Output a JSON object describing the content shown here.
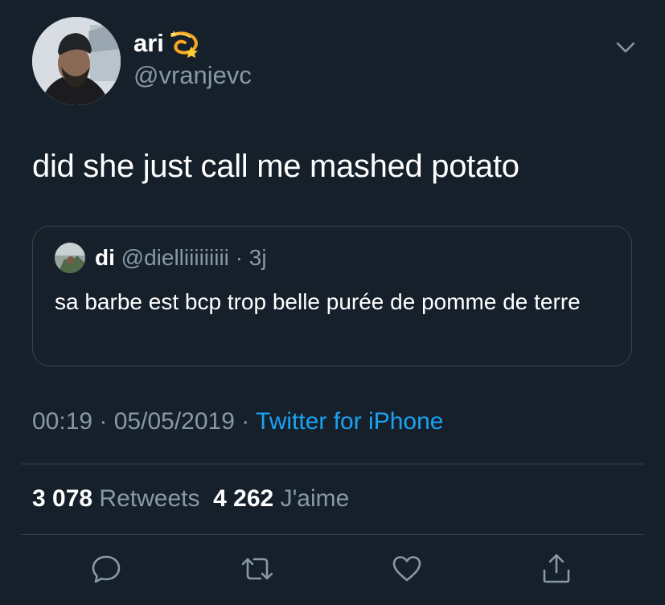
{
  "author": {
    "name": "ari",
    "name_emoji_icon": "dizzy-icon",
    "handle": "@vranjevc"
  },
  "tweet": {
    "text": "did she just call me mashed potato"
  },
  "quoted_tweet": {
    "name": "di",
    "handle": "@dielliiiiiiiii",
    "separator": "·",
    "time": "3j",
    "text": "sa barbe est bcp trop belle purée de pomme de terre"
  },
  "meta": {
    "time": "00:19",
    "separator1": " · ",
    "date": "05/05/2019",
    "separator2": " · ",
    "source": "Twitter for iPhone"
  },
  "stats": {
    "retweets_count": "3 078",
    "retweets_label": "Retweets",
    "likes_count": "4 262",
    "likes_label": "J'aime"
  },
  "icons": {
    "reply": "reply-icon",
    "retweet": "retweet-icon",
    "like": "like-icon",
    "share": "share-icon",
    "menu": "chevron-down-icon"
  },
  "colors": {
    "background": "#15202b",
    "text": "#ffffff",
    "secondary": "#8899a6",
    "link": "#1da1f2",
    "border": "#38444d"
  }
}
